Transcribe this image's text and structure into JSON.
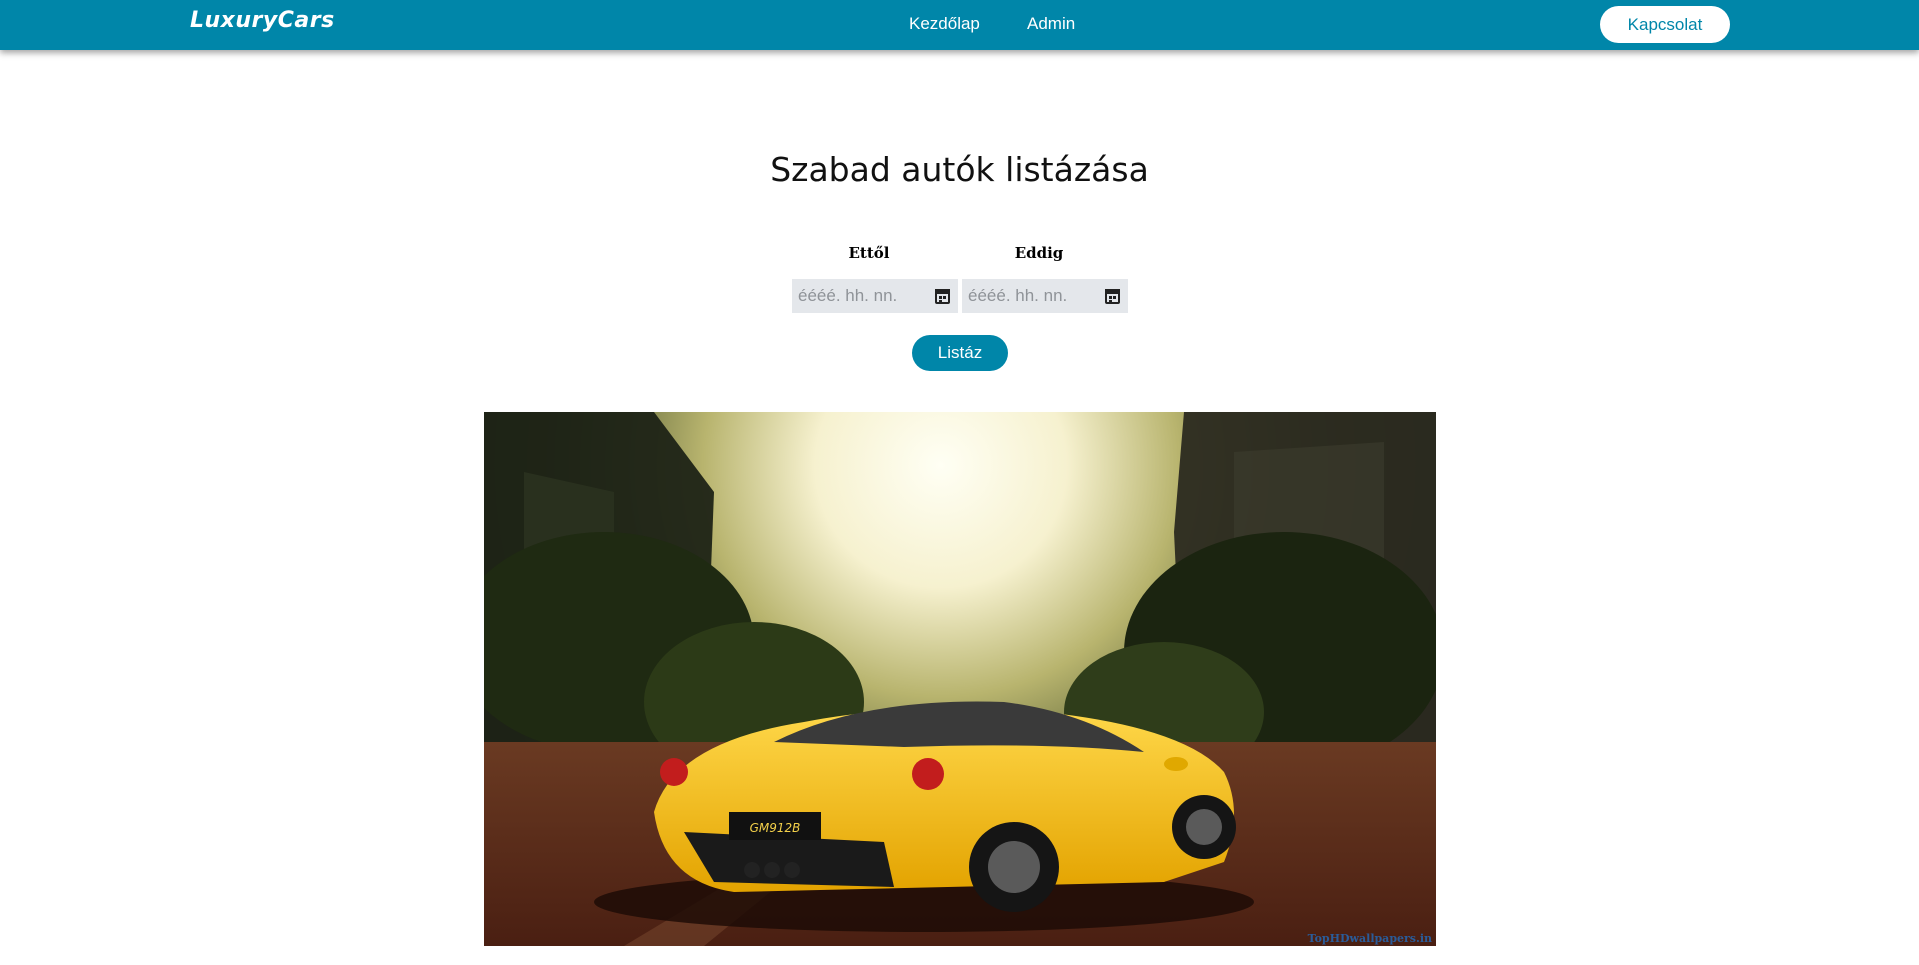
{
  "navbar": {
    "logo": "LuxuryCars",
    "links": [
      "Kezdőlap",
      "Admin"
    ],
    "contact_label": "Kapcsolat",
    "brand_color": "#0086a9"
  },
  "main": {
    "title": "Szabad autók listázása",
    "from_label": "Ettől",
    "to_label": "Eddig",
    "from_placeholder": "éééé. hh. nn.",
    "to_placeholder": "éééé. hh. nn.",
    "list_button": "Listáz"
  },
  "hero": {
    "plate": "GM912B",
    "watermark": "TopHDwallpapers.in"
  }
}
